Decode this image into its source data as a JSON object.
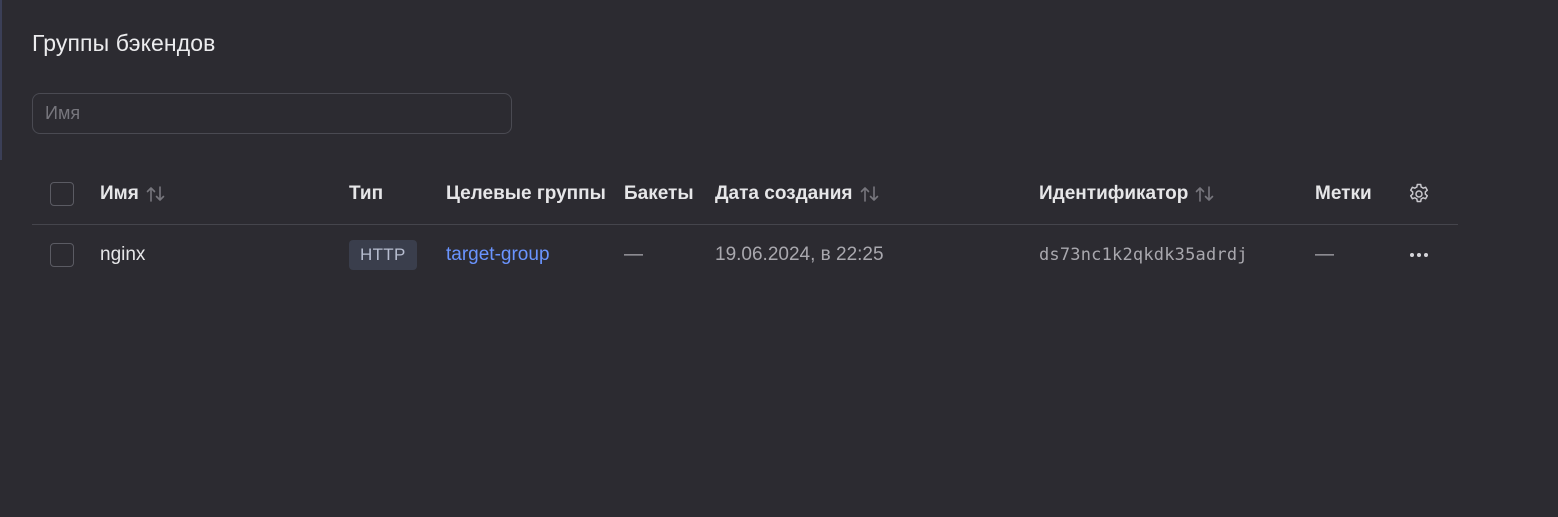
{
  "page": {
    "title": "Группы бэкендов"
  },
  "search": {
    "placeholder": "Имя",
    "value": ""
  },
  "table": {
    "columns": {
      "name": "Имя",
      "type": "Тип",
      "target_groups": "Целевые группы",
      "buckets": "Бакеты",
      "created": "Дата создания",
      "id": "Идентификатор",
      "labels": "Метки"
    },
    "sortable": [
      "name",
      "created",
      "id"
    ],
    "rows": [
      {
        "name": "nginx",
        "type": "HTTP",
        "target_groups": "target-group",
        "buckets": "—",
        "created": "19.06.2024, в 22:25",
        "id": "ds73nc1k2qkdk35adrdj",
        "labels": "—"
      }
    ]
  },
  "icons": {
    "sort": "sort-arrows-icon",
    "settings": "gear-icon",
    "row_actions": "more-horizontal-icon"
  },
  "colors": {
    "background": "#2c2b31",
    "link": "#6a94ff",
    "badge_bg": "#3a3e4c"
  }
}
